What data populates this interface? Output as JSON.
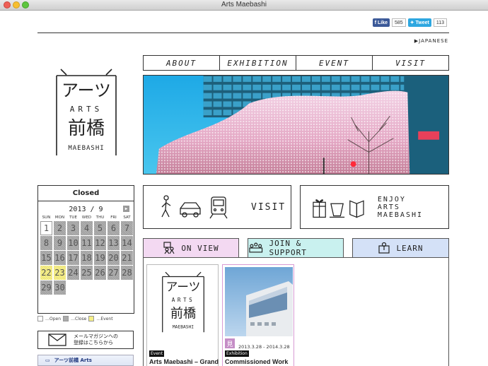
{
  "window": {
    "title": "Arts Maebashi"
  },
  "social": {
    "like_label": "Like",
    "like_count": "585",
    "tweet_label": "Tweet",
    "tweet_count": "113"
  },
  "language_link": "JAPANESE",
  "logo": {
    "katakana": "アーツ",
    "arts": "ARTS",
    "kanji": "前橋",
    "maebashi": "MAEBASHI"
  },
  "nav": [
    "ABOUT",
    "EXHIBITION",
    "EVENT",
    "VISIT"
  ],
  "calendar": {
    "status": "Closed",
    "month": "2013 / 9",
    "weekdays": [
      "SUN",
      "MON",
      "TUE",
      "WED",
      "THU",
      "FRI",
      "SAT"
    ],
    "days": [
      {
        "d": "1",
        "s": "open"
      },
      {
        "d": "2",
        "s": "close"
      },
      {
        "d": "3",
        "s": "close"
      },
      {
        "d": "4",
        "s": "close"
      },
      {
        "d": "5",
        "s": "close"
      },
      {
        "d": "6",
        "s": "close"
      },
      {
        "d": "7",
        "s": "close"
      },
      {
        "d": "8",
        "s": "close"
      },
      {
        "d": "9",
        "s": "close"
      },
      {
        "d": "10",
        "s": "close"
      },
      {
        "d": "11",
        "s": "close"
      },
      {
        "d": "12",
        "s": "close"
      },
      {
        "d": "13",
        "s": "close"
      },
      {
        "d": "14",
        "s": "close"
      },
      {
        "d": "15",
        "s": "close"
      },
      {
        "d": "16",
        "s": "close"
      },
      {
        "d": "17",
        "s": "close"
      },
      {
        "d": "18",
        "s": "close"
      },
      {
        "d": "19",
        "s": "close"
      },
      {
        "d": "20",
        "s": "close"
      },
      {
        "d": "21",
        "s": "close"
      },
      {
        "d": "22",
        "s": "event"
      },
      {
        "d": "23",
        "s": "event"
      },
      {
        "d": "24",
        "s": "close"
      },
      {
        "d": "25",
        "s": "close"
      },
      {
        "d": "26",
        "s": "close"
      },
      {
        "d": "27",
        "s": "close"
      },
      {
        "d": "28",
        "s": "close"
      },
      {
        "d": "29",
        "s": "close"
      },
      {
        "d": "30",
        "s": "close"
      }
    ],
    "legend": {
      "open": "…Open",
      "close": "…Close",
      "event": "…Event"
    }
  },
  "newsletter": {
    "line1": "メールマガジンへの",
    "line2": "登録はこちらから"
  },
  "mini_banner": "アーツ前橋 Arts",
  "buttons": {
    "visit": "VISIT",
    "enjoy_line1": "ENJOY",
    "enjoy_line2": "ARTS MAEBASHI"
  },
  "tabs": {
    "on_view": "ON VIEW",
    "join": "JOIN & SUPPORT",
    "learn": "LEARN"
  },
  "cards": [
    {
      "tag": "Event",
      "title": "Arts Maebashi – Grand"
    },
    {
      "tag": "Exhibition",
      "badge": "見",
      "date": "2013.3.28 - 2014.3.28",
      "title": "Commissioned Work"
    }
  ],
  "colors": {
    "tab_onview": "#f3d9f2",
    "tab_join": "#c9f1ef",
    "tab_learn": "#d4e1f7",
    "event_day": "#f5ef86"
  }
}
